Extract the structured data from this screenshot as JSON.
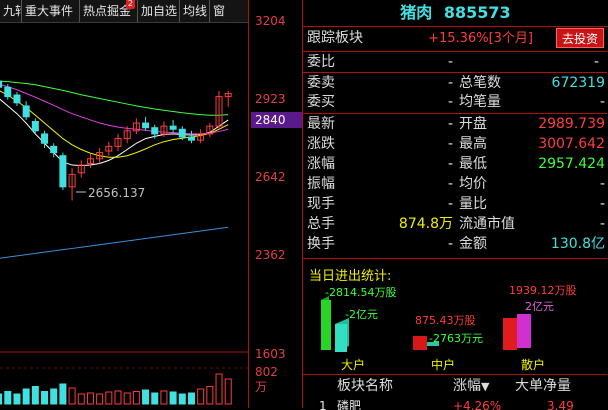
{
  "toolbar": {
    "tabs": [
      "九转",
      "重大事件",
      "热点掘金",
      "加自选",
      "均线",
      "窗"
    ],
    "badge": "2"
  },
  "chart": {
    "price_axis": [
      "3204",
      "2923",
      "2840",
      "2642",
      "2362"
    ],
    "volume_axis": [
      "1603",
      "802",
      "万"
    ],
    "low_annotation": "2656.137",
    "current_price_marker": "2840"
  },
  "chart_data": {
    "type": "candlestick",
    "ylim": [
      2362,
      3204
    ],
    "candles": [
      {
        "o": 3040,
        "c": 3020,
        "h": 3060,
        "l": 3010
      },
      {
        "o": 3020,
        "c": 2990,
        "h": 3030,
        "l": 2980
      },
      {
        "o": 2995,
        "c": 2970,
        "h": 3005,
        "l": 2960
      },
      {
        "o": 2960,
        "c": 2925,
        "h": 2975,
        "l": 2915
      },
      {
        "o": 2910,
        "c": 2880,
        "h": 2920,
        "l": 2870
      },
      {
        "o": 2870,
        "c": 2840,
        "h": 2880,
        "l": 2825
      },
      {
        "o": 2830,
        "c": 2810,
        "h": 2840,
        "l": 2795
      },
      {
        "o": 2800,
        "c": 2700,
        "h": 2810,
        "l": 2690
      },
      {
        "o": 2700,
        "c": 2740,
        "h": 2760,
        "l": 2656
      },
      {
        "o": 2745,
        "c": 2770,
        "h": 2785,
        "l": 2730
      },
      {
        "o": 2775,
        "c": 2790,
        "h": 2805,
        "l": 2760
      },
      {
        "o": 2790,
        "c": 2810,
        "h": 2825,
        "l": 2775
      },
      {
        "o": 2815,
        "c": 2830,
        "h": 2845,
        "l": 2800
      },
      {
        "o": 2830,
        "c": 2855,
        "h": 2870,
        "l": 2815
      },
      {
        "o": 2855,
        "c": 2880,
        "h": 2895,
        "l": 2840
      },
      {
        "o": 2880,
        "c": 2905,
        "h": 2920,
        "l": 2870
      },
      {
        "o": 2905,
        "c": 2890,
        "h": 2925,
        "l": 2880
      },
      {
        "o": 2890,
        "c": 2870,
        "h": 2900,
        "l": 2855
      },
      {
        "o": 2870,
        "c": 2895,
        "h": 2910,
        "l": 2860
      },
      {
        "o": 2895,
        "c": 2885,
        "h": 2915,
        "l": 2875
      },
      {
        "o": 2885,
        "c": 2860,
        "h": 2895,
        "l": 2850
      },
      {
        "o": 2860,
        "c": 2850,
        "h": 2880,
        "l": 2840
      },
      {
        "o": 2850,
        "c": 2870,
        "h": 2885,
        "l": 2840
      },
      {
        "o": 2870,
        "c": 2895,
        "h": 2905,
        "l": 2860
      },
      {
        "o": 2895,
        "c": 2990,
        "h": 3008,
        "l": 2885
      },
      {
        "o": 2990,
        "c": 3000,
        "h": 3008,
        "l": 2957
      }
    ],
    "volumes": [
      2,
      2.5,
      2,
      3,
      3.5,
      2.5,
      3,
      4,
      3.2,
      2,
      2.2,
      2,
      2.4,
      2.6,
      2.2,
      2.5,
      2.8,
      2.2,
      2.6,
      2.4,
      2.0,
      2.2,
      3,
      3.5,
      6,
      5
    ],
    "ma_lines": [
      {
        "name": "",
        "color": "#ffffff",
        "values": [
          2985,
          2960,
          2935,
          2905,
          2870,
          2840,
          2810,
          2780,
          2770,
          2768,
          2770,
          2775,
          2785,
          2800,
          2820,
          2840,
          2855,
          2862,
          2868,
          2870,
          2868,
          2866,
          2868,
          2875,
          2895,
          2915
        ]
      },
      {
        "name": "",
        "color": "#f0f000",
        "values": [
          3010,
          2995,
          2975,
          2955,
          2930,
          2905,
          2880,
          2855,
          2835,
          2820,
          2808,
          2800,
          2795,
          2795,
          2800,
          2810,
          2822,
          2835,
          2845,
          2852,
          2856,
          2860,
          2865,
          2872,
          2885,
          2900
        ]
      },
      {
        "name": "",
        "color": "#e040e0",
        "values": [
          3030,
          3022,
          3012,
          3000,
          2988,
          2975,
          2962,
          2948,
          2935,
          2925,
          2915,
          2905,
          2898,
          2892,
          2888,
          2885,
          2882,
          2878,
          2876,
          2874,
          2872,
          2870,
          2870,
          2872,
          2878,
          2885
        ]
      },
      {
        "name": "",
        "color": "#40ff40",
        "values": [
          3040,
          3038,
          3035,
          3032,
          3028,
          3022,
          3016,
          3010,
          3003,
          2996,
          2990,
          2984,
          2978,
          2972,
          2966,
          2960,
          2955,
          2950,
          2946,
          2942,
          2938,
          2935,
          2932,
          2930,
          2930,
          2932
        ]
      },
      {
        "name": "",
        "color": "#3a8fd8",
        "values": [
          2470,
          2474,
          2478,
          2482,
          2486,
          2490,
          2494,
          2498,
          2502,
          2506,
          2510,
          2514,
          2518,
          2522,
          2526,
          2530,
          2534,
          2538,
          2542,
          2546,
          2550,
          2554,
          2558,
          2562,
          2566,
          2570
        ]
      }
    ]
  },
  "panel": {
    "name": "猪肉",
    "code": "885573",
    "tracking_label": "跟踪板块",
    "tracking_value": "+15.36%[3个月]",
    "invest_button": "去投资",
    "weibi_label": "委比",
    "weibi_value": "-",
    "sell_label": "委卖",
    "sell_value": "-",
    "buy_label": "委买",
    "buy_value": "-",
    "total_orders_label": "总笔数",
    "total_orders_value": "672319",
    "avg_orders_label": "均笔量",
    "avg_orders_value": "-",
    "latest_label": "最新",
    "latest_value": "-",
    "open_label": "开盘",
    "open_value": "2989.739",
    "change_label": "涨跌",
    "change_value": "-",
    "high_label": "最高",
    "high_value": "3007.642",
    "pct_label": "涨幅",
    "pct_value": "-",
    "low_label": "最低",
    "low_value": "2957.424",
    "amp_label": "振幅",
    "amp_value": "-",
    "avgp_label": "均价",
    "avgp_value": "-",
    "cur_label": "现手",
    "cur_value": "-",
    "vr_label": "量比",
    "vr_value": "-",
    "totalvol_label": "总手",
    "totalvol_value": "874.8万",
    "float_label": "流通市值",
    "float_value": "-",
    "turnover_label": "换手",
    "turnover_value": "-",
    "amount_label": "金额",
    "amount_value": "130.8亿"
  },
  "flow": {
    "title": "当日进出统计:",
    "large_top": "-2814.54万股",
    "large_sub": "-2亿元",
    "large_label": "大户",
    "mid_top": "875.43万股",
    "mid_sub": "-2763万元",
    "mid_label": "中户",
    "retail_top": "1939.12万股",
    "retail_sub": "2亿元",
    "retail_label": "散户"
  },
  "table": {
    "col_name": "板块名称",
    "col_pct": "涨幅",
    "col_net": "大单净量",
    "row1_idx": "1",
    "row1_name": "磷肥",
    "row1_pct": "+4.26%",
    "row1_net": "3.49"
  }
}
